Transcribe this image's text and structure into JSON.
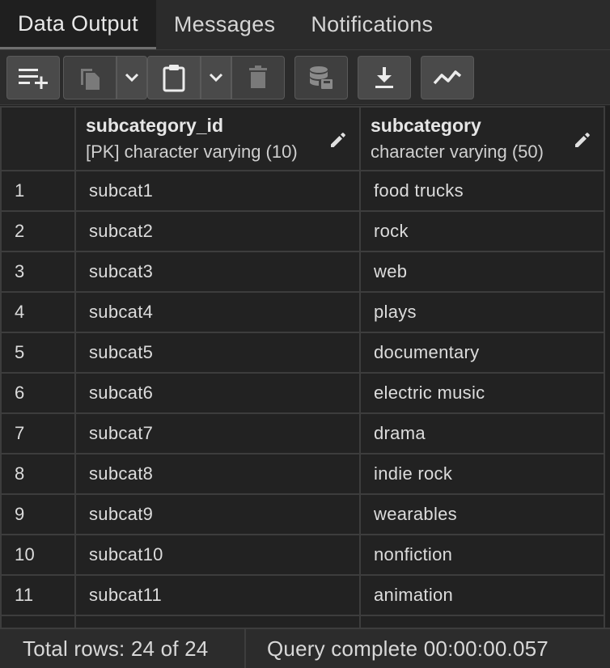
{
  "tabs": [
    {
      "label": "Data Output",
      "active": true
    },
    {
      "label": "Messages",
      "active": false
    },
    {
      "label": "Notifications",
      "active": false
    }
  ],
  "toolbar": {
    "buttons": [
      {
        "icon": "add-row-icon"
      },
      {
        "icon": "copy-icon"
      },
      {
        "icon": "chevron-down-icon"
      },
      {
        "icon": "paste-icon"
      },
      {
        "icon": "chevron-down-icon"
      },
      {
        "icon": "delete-icon"
      },
      {
        "icon": "save-data-icon"
      },
      {
        "icon": "download-icon"
      },
      {
        "icon": "graph-visualiser-icon"
      }
    ]
  },
  "grid": {
    "columns": [
      {
        "name": "subcategory_id",
        "type": "[PK] character varying (10)"
      },
      {
        "name": "subcategory",
        "type": "character varying (50)"
      }
    ],
    "rows": [
      {
        "n": "1",
        "id": "subcat1",
        "sub": "food trucks"
      },
      {
        "n": "2",
        "id": "subcat2",
        "sub": "rock"
      },
      {
        "n": "3",
        "id": "subcat3",
        "sub": "web"
      },
      {
        "n": "4",
        "id": "subcat4",
        "sub": "plays"
      },
      {
        "n": "5",
        "id": "subcat5",
        "sub": "documentary"
      },
      {
        "n": "6",
        "id": "subcat6",
        "sub": "electric music"
      },
      {
        "n": "7",
        "id": "subcat7",
        "sub": "drama"
      },
      {
        "n": "8",
        "id": "subcat8",
        "sub": "indie rock"
      },
      {
        "n": "9",
        "id": "subcat9",
        "sub": "wearables"
      },
      {
        "n": "10",
        "id": "subcat10",
        "sub": "nonfiction"
      },
      {
        "n": "11",
        "id": "subcat11",
        "sub": "animation"
      }
    ]
  },
  "status": {
    "total_rows": "Total rows: 24 of 24",
    "query_status": "Query complete 00:00:00.057"
  },
  "colors": {
    "background": "#222222",
    "toolbar_button": "#4a4a4a",
    "grid_border": "#3d3d3d",
    "text": "#e6e6e6"
  }
}
